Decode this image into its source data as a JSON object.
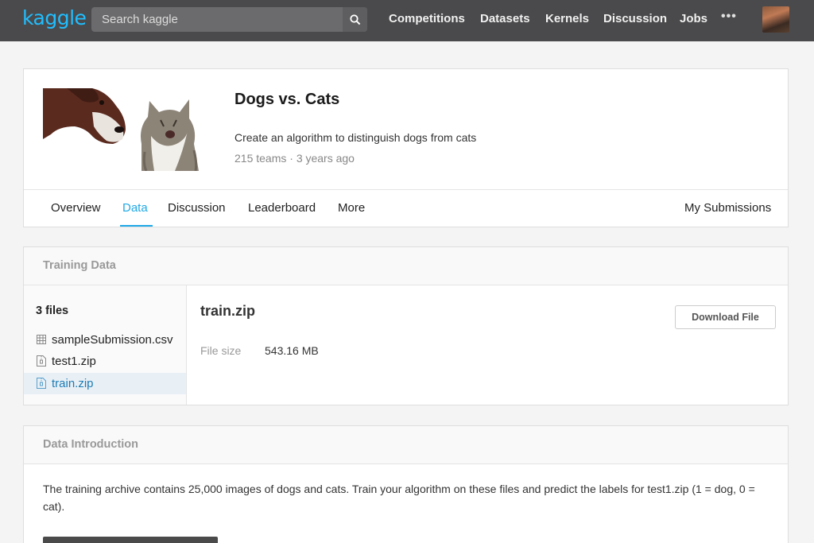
{
  "topbar": {
    "logo": "kaggle",
    "search_placeholder": "Search kaggle",
    "nav": [
      "Competitions",
      "Datasets",
      "Kernels",
      "Discussion",
      "Jobs"
    ],
    "more": "•••"
  },
  "competition": {
    "title": "Dogs vs. Cats",
    "description": "Create an algorithm to distinguish dogs from cats",
    "meta": "215 teams · 3 years ago",
    "tabs": [
      "Overview",
      "Data",
      "Discussion",
      "Leaderboard",
      "More"
    ],
    "active_tab": "Data",
    "my_submissions": "My Submissions"
  },
  "training_data": {
    "section_title": "Training Data",
    "files_count": "3 files",
    "files": [
      {
        "name": "sampleSubmission.csv",
        "icon": "table-icon"
      },
      {
        "name": "test1.zip",
        "icon": "zip-file-icon"
      },
      {
        "name": "train.zip",
        "icon": "zip-file-icon"
      }
    ],
    "selected_file": "train.zip",
    "detail_title": "train.zip",
    "download_label": "Download File",
    "file_size_label": "File size",
    "file_size_value": "543.16 MB"
  },
  "data_intro": {
    "section_title": "Data Introduction",
    "text": "The training archive contains 25,000 images of dogs and cats. Train your algorithm on these files and predict the labels for test1.zip (1 = dog, 0 = cat)."
  },
  "colors": {
    "brand": "#20beff",
    "active_tab": "#20a9e6",
    "topbar": "#4a4a4c"
  }
}
